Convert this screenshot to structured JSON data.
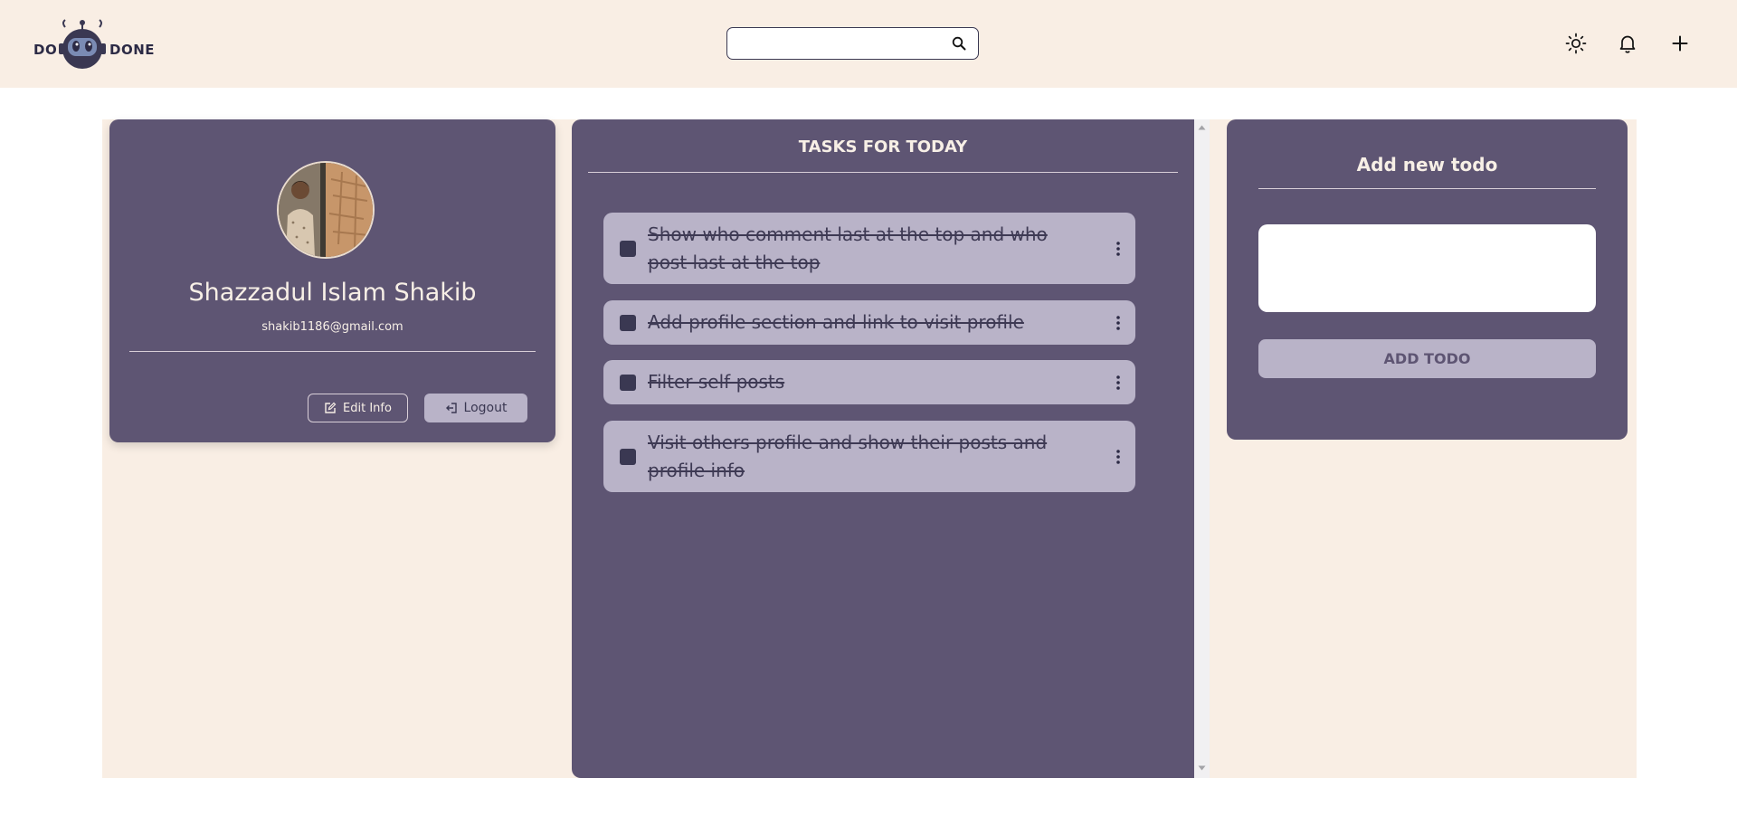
{
  "app": {
    "logo_left": "DO",
    "logo_right": "DONE",
    "logo_icon": "robot-icon"
  },
  "header": {
    "search_placeholder": "",
    "search_icon": "search-icon",
    "icons": [
      "sun-icon",
      "bell-icon",
      "plus-icon"
    ]
  },
  "profile": {
    "name": "Shazzadul Islam Shakib",
    "email": "shakib1186@gmail.com",
    "edit_label": "Edit Info",
    "logout_label": "Logout"
  },
  "tasks": {
    "title": "TASKS FOR TODAY",
    "items": [
      {
        "text": "Show who comment last at the top and who post last at the top",
        "completed": true
      },
      {
        "text": "Add profile section and link to visit profile",
        "completed": true
      },
      {
        "text": "Filter self posts",
        "completed": true
      },
      {
        "text": "Visit others profile and show their posts and profile info",
        "completed": true
      }
    ]
  },
  "add_todo": {
    "title": "Add new todo",
    "input_value": "",
    "button_label": "ADD TODO"
  },
  "colors": {
    "header_bg": "#f9eee4",
    "panel": "#5e5573",
    "task_bg": "#b9b3c8",
    "dark": "#3a3852",
    "text_light": "#f7efe6"
  }
}
